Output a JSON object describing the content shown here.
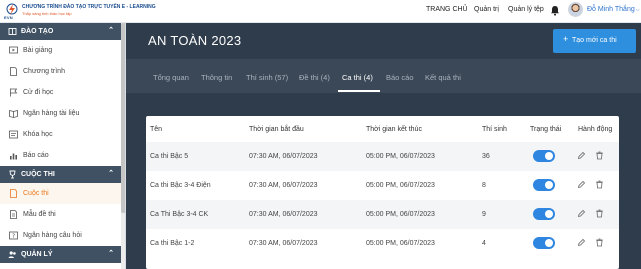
{
  "header": {
    "brand_title": "CHƯƠNG TRÌNH ĐÀO TẠO TRỰC TUYẾN E - LEARNING",
    "brand_sub": "Thắp sáng tinh thần học tập",
    "logo_text": "EVN",
    "nav": [
      "TRANG CHỦ",
      "Quản trị",
      "Quản lý tệp"
    ],
    "user": "Đỗ Minh Thắng"
  },
  "sidebar": {
    "sections": [
      {
        "title": "ĐÀO TẠO",
        "items": [
          "Bài giảng",
          "Chương trình",
          "Cử đi học",
          "Ngân hàng tài liệu",
          "Khóa học",
          "Báo cáo"
        ]
      },
      {
        "title": "CUỘC THI",
        "items": [
          "Cuộc thi",
          "Mẫu đề thi",
          "Ngân hàng câu hỏi"
        ]
      },
      {
        "title": "QUẢN LÝ",
        "items": []
      }
    ],
    "active_item": "Cuộc thi"
  },
  "main": {
    "title": "AN TOÀN 2023",
    "create_button": "Tạo mới ca thi",
    "tabs": [
      "Tổng quan",
      "Thông tin",
      "Thí sinh (57)",
      "Đề thi (4)",
      "Ca thi (4)",
      "Báo cáo",
      "Kết quả thi"
    ],
    "active_tab": "Ca thi (4)",
    "table": {
      "headers": [
        "Tên",
        "Thời gian bắt đầu",
        "Thời gian kết thúc",
        "Thí sinh",
        "Trạng thái",
        "Hành động"
      ],
      "rows": [
        {
          "name": "Ca thi Bậc 5",
          "start": "07:30 AM, 06/07/2023",
          "end": "05:00 PM, 06/07/2023",
          "candidates": "36",
          "status": true
        },
        {
          "name": "Ca thi Bậc 3-4 Điện",
          "start": "07:30 AM, 06/07/2023",
          "end": "05:00 PM, 06/07/2023",
          "candidates": "8",
          "status": true
        },
        {
          "name": "Ca Thi Bậc 3-4 CK",
          "start": "07:30 AM, 06/07/2023",
          "end": "05:00 PM, 06/07/2023",
          "candidates": "9",
          "status": true
        },
        {
          "name": "Ca thi Bậc 1-2",
          "start": "07:30 AM, 06/07/2023",
          "end": "05:00 PM, 06/07/2023",
          "candidates": "4",
          "status": true
        }
      ]
    }
  },
  "colors": {
    "sidebar_header": "#3f5163",
    "main_bg": "#2f3c4b",
    "accent_blue": "#2f8fdf",
    "active_orange": "#e8761e"
  }
}
